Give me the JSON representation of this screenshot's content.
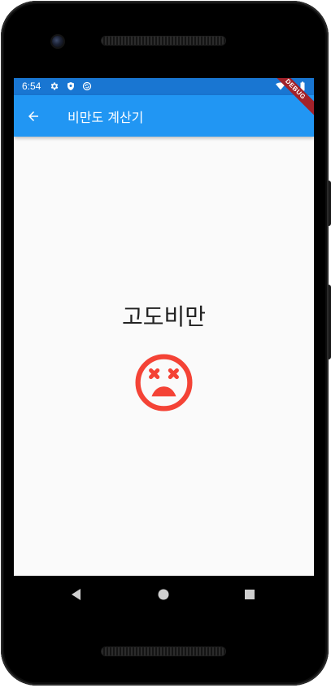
{
  "status_bar": {
    "time": "6:54",
    "icons": [
      "settings-icon",
      "shield-icon",
      "sync-icon",
      "wifi-icon",
      "battery-icon"
    ],
    "background": "#1976d2"
  },
  "app_bar": {
    "back_icon": "arrow-back-icon",
    "title": "비만도 계산기",
    "background": "#2196f3"
  },
  "debug_banner": {
    "label": "DEBUG"
  },
  "result": {
    "label": "고도비만",
    "icon": "sentiment-very-dissatisfied-icon",
    "icon_color": "#f44336"
  },
  "nav_bar": {
    "buttons": [
      "back-triangle-icon",
      "home-circle-icon",
      "recents-square-icon"
    ]
  }
}
